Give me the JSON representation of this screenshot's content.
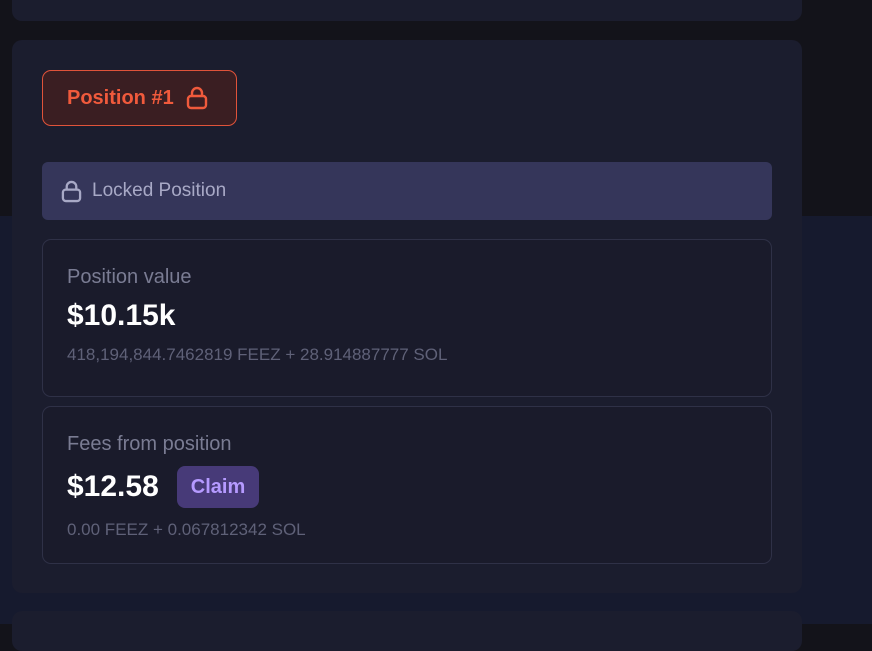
{
  "position": {
    "tag_label": "Position #1",
    "tag_icon": "lock-icon",
    "locked_label": "Locked Position",
    "locked_icon": "lock-icon"
  },
  "value_box": {
    "label": "Position value",
    "amount": "$10.15k",
    "breakdown": "418,194,844.7462819 FEEZ + 28.914887777 SOL"
  },
  "fees_box": {
    "label": "Fees from position",
    "amount": "$12.58",
    "claim_label": "Claim",
    "breakdown": "0.00 FEEZ + 0.067812342 SOL"
  },
  "colors": {
    "accent_red": "#f05a3c",
    "claim_purple": "#b59aff",
    "card_bg": "#1b1d2e"
  }
}
